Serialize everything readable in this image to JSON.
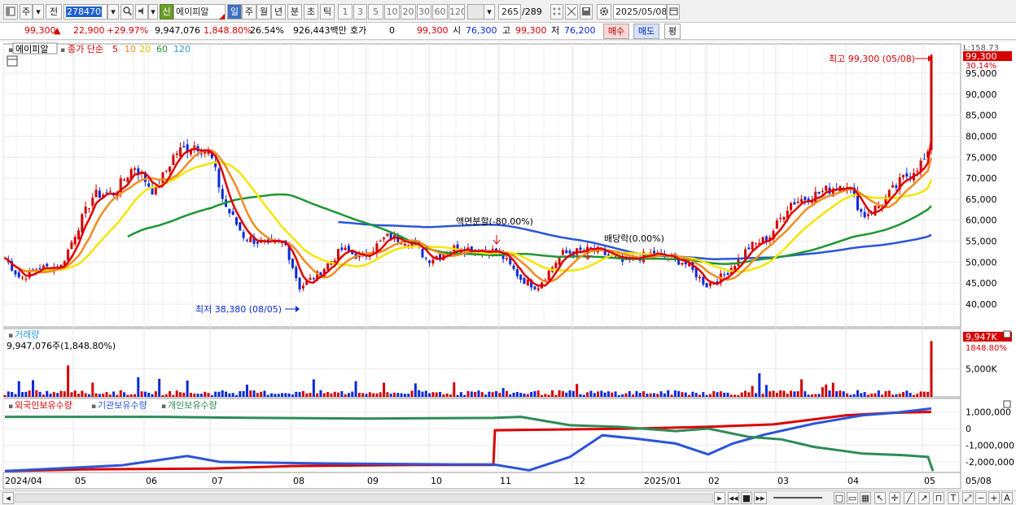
{
  "toolbar": {
    "market": "주",
    "kind": "전",
    "code": "278470",
    "credit_badge": "신",
    "name": "에이피알",
    "periods": [
      "일",
      "주",
      "월",
      "년",
      "분",
      "초",
      "틱"
    ],
    "intervals": [
      "1",
      "3",
      "5",
      "10",
      "20",
      "30",
      "60",
      "120"
    ],
    "count": "265",
    "total": "/289",
    "date": "2025/05/08"
  },
  "quote": {
    "price": "99,300",
    "arrow": "▲",
    "change": "22,900",
    "change_pct": "+29.97%",
    "volume": "9,947,076",
    "volume_pct": "1,848.80%",
    "turnover": "26.54%",
    "amount": "926,443백만",
    "hoga_label": "호가",
    "hoga_value": "0",
    "hoga_price": "99,300",
    "open_label": "시",
    "open": "76,300",
    "high_label": "고",
    "high": "99,300",
    "low_label": "저",
    "low": "76,200",
    "buy": "매수",
    "sell": "매도",
    "avg": "평"
  },
  "price_legend": {
    "name": "에이피알",
    "ma_label": "종가 단순",
    "ma_periods": [
      "5",
      "10",
      "20",
      "60",
      "120"
    ]
  },
  "price_axis": {
    "ticks": [
      "95,000",
      "90,000",
      "85,000",
      "80,000",
      "75,000",
      "70,000",
      "65,000",
      "60,000",
      "55,000",
      "50,000",
      "45,000",
      "40,000"
    ],
    "top_label": "L:158.73",
    "current": "99,300",
    "current_pct": "30.14%"
  },
  "annotations": {
    "high": "최고 99,300 (05/08)",
    "low": "최저 38,380 (08/05)",
    "split": "액면분할(-80.00%)",
    "dividend": "배당락(0.00%)"
  },
  "volume_panel": {
    "title": "거래량",
    "value": "9,947,076주(1,848.80%)",
    "tick": "5,000K",
    "current": "9,947K",
    "current_pct": "1848.80%"
  },
  "holdings_panel": {
    "foreign": "외국인보유수량",
    "institution": "기관보유수량",
    "individual": "개인보유수량",
    "ticks": [
      "1,000,000",
      "0",
      "-1,000,000",
      "-2,000,000"
    ]
  },
  "x_axis": {
    "labels": [
      "2024/04",
      "05",
      "06",
      "07",
      "08",
      "09",
      "10",
      "11",
      "12",
      "2025/01",
      "02",
      "03",
      "04",
      "05"
    ],
    "end_label": "05/08"
  },
  "colors": {
    "up": "#d40000",
    "down": "#0a2ad8",
    "ma5": "#dd0000",
    "ma10": "#f08c1e",
    "ma20": "#f5e600",
    "ma60": "#1e9632",
    "ma120": "#2a55d8",
    "foreign": "#dd0000",
    "institution": "#2a55d8",
    "individual": "#2e8b57"
  }
}
